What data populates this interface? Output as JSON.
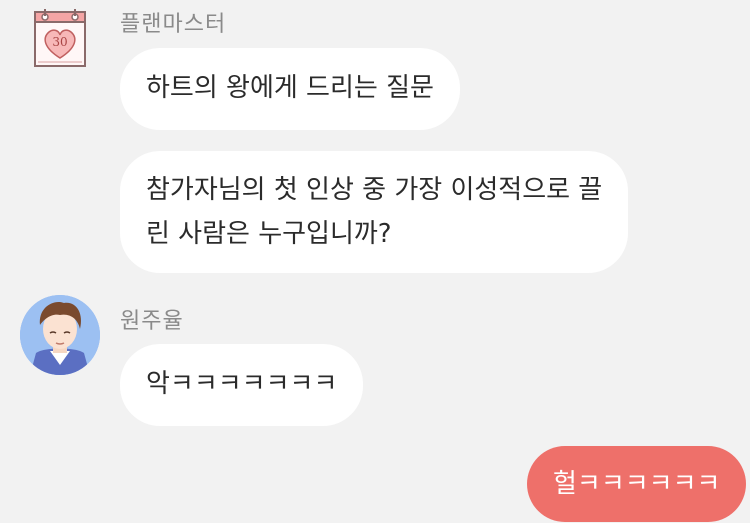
{
  "host": {
    "name": "플랜마스터",
    "avatar_icon": "calendar-heart-icon",
    "avatar_day": "30",
    "messages": [
      {
        "lines": [
          "하트의 왕에게 드리는 질문"
        ]
      },
      {
        "lines": [
          "참가자님의 첫 인상 중 가장 이성적으로 끌",
          "린 사람은 누구입니까?"
        ]
      }
    ]
  },
  "participant": {
    "name": "원주율",
    "avatar_icon": "profile-portrait",
    "messages": [
      {
        "lines": [
          "악ㅋㅋㅋㅋㅋㅋㅋ"
        ]
      }
    ]
  },
  "me": {
    "messages": [
      {
        "lines": [
          "헐ㅋㅋㅋㅋㅋㅋ"
        ]
      }
    ]
  },
  "colors": {
    "background": "#f2f2f2",
    "incoming_bubble": "#ffffff",
    "outgoing_bubble": "#ee706a",
    "name_text": "#8a8a8a",
    "message_text": "#2b2b2b"
  }
}
